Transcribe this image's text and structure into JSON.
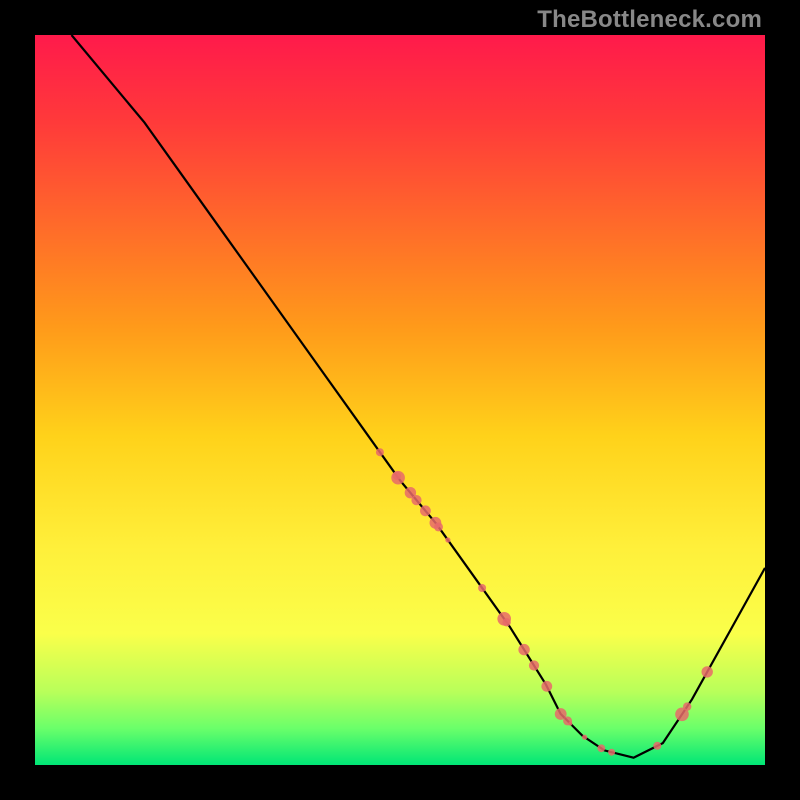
{
  "watermark": "TheBottleneck.com",
  "chart_data": {
    "type": "line",
    "title": "",
    "xlabel": "",
    "ylabel": "",
    "xlim": [
      0,
      100
    ],
    "ylim": [
      0,
      100
    ],
    "grid": false,
    "legend": false,
    "series": [
      {
        "name": "curve",
        "x": [
          5,
          10,
          15,
          20,
          25,
          30,
          35,
          40,
          45,
          50,
          55,
          60,
          65,
          70,
          72,
          75,
          78,
          82,
          86,
          90,
          95,
          100
        ],
        "y": [
          100,
          94,
          88,
          81,
          74,
          67,
          60,
          53,
          46,
          39,
          33,
          26,
          19,
          11,
          7,
          4,
          2,
          1,
          3,
          9,
          18,
          27
        ]
      }
    ],
    "marker_clusters": [
      {
        "x_range": [
          48,
          58
        ],
        "y_range": [
          28,
          42
        ],
        "count": 10
      },
      {
        "x_range": [
          62,
          80
        ],
        "y_range": [
          1,
          14
        ],
        "count": 12
      },
      {
        "x_range": [
          86,
          92
        ],
        "y_range": [
          8,
          16
        ],
        "count": 4
      }
    ]
  }
}
